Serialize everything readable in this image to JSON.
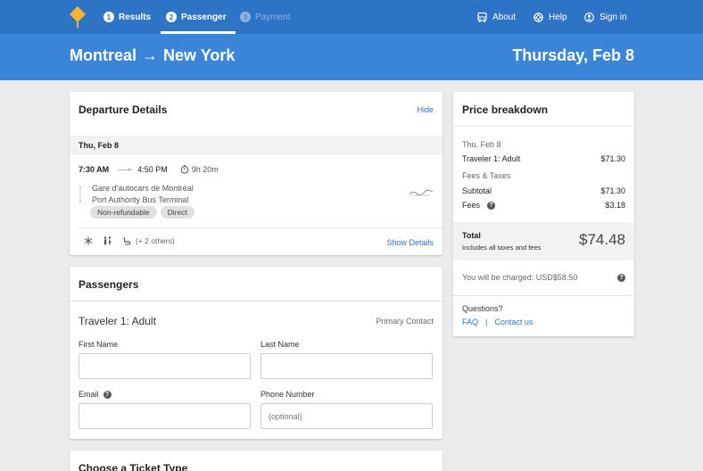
{
  "nav": {
    "steps": [
      {
        "num": "1",
        "label": "Results"
      },
      {
        "num": "2",
        "label": "Passenger"
      },
      {
        "num": "3",
        "label": "Payment"
      }
    ],
    "about": "About",
    "help": "Help",
    "signin": "Sign in"
  },
  "header": {
    "origin": "Montreal",
    "arrow": "→",
    "destination": "New York",
    "date": "Thursday, Feb 8"
  },
  "departure": {
    "title": "Departure Details",
    "hide": "Hide",
    "day": "Thu, Feb 8",
    "depart_time": "7:30 AM",
    "arrive_time": "4:50 PM",
    "duration": "9h 20m",
    "from_station": "Gare d'autocars de Montréal",
    "to_station": "Port Authority Bus Terminal",
    "badges": [
      "Non-refundable",
      "Direct"
    ],
    "others": "(+ 2 others)",
    "show_details": "Show Details"
  },
  "passengers": {
    "title": "Passengers",
    "traveler": "Traveler 1: Adult",
    "primary": "Primary Contact",
    "first_name_label": "First Name",
    "last_name_label": "Last Name",
    "email_label": "Email",
    "phone_label": "Phone Number",
    "phone_placeholder": "(optional)"
  },
  "ticket": {
    "title": "Choose a Ticket Type"
  },
  "price": {
    "title": "Price breakdown",
    "day": "Thu, Feb 8",
    "traveler_label": "Traveler 1: Adult",
    "traveler_amount": "$71.30",
    "fees_taxes": "Fees & Taxes",
    "subtotal_label": "Subtotal",
    "subtotal_amount": "$71.30",
    "fees_label": "Fees",
    "fees_amount": "$3.18",
    "total_label": "Total",
    "total_sub": "Includes all taxes and fees",
    "total_amount": "$74.48",
    "charged": "You will be charged: USD$58.50",
    "questions": "Questions?",
    "faq": "FAQ",
    "pipe": "|",
    "contact": "Contact us"
  },
  "colors": {
    "nav_bg": "#2d73c6",
    "band_bg": "#3a85d8",
    "link": "#2d73c6",
    "logo": "#f5b52e"
  }
}
